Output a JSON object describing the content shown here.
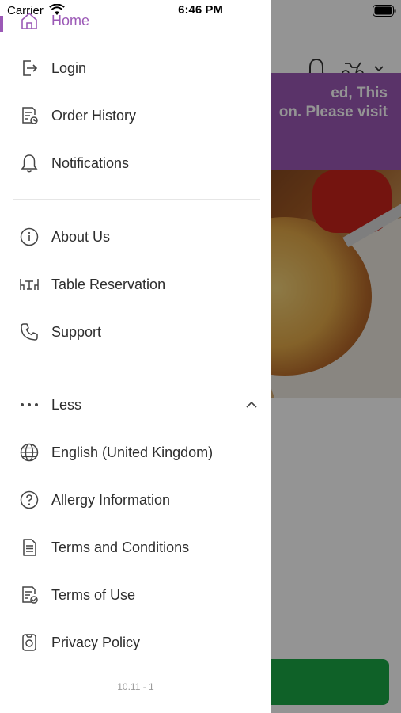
{
  "status_bar": {
    "carrier": "Carrier",
    "time": "6:46 PM"
  },
  "background": {
    "banner_text": "ed, This\non. Please visit\n"
  },
  "menu": {
    "home": "Home",
    "login": "Login",
    "order_history": "Order History",
    "notifications": "Notifications",
    "about_us": "About Us",
    "table_reservation": "Table Reservation",
    "support": "Support",
    "less": "Less",
    "language": "English (United Kingdom)",
    "allergy_information": "Allergy Information",
    "terms_and_conditions": "Terms and Conditions",
    "terms_of_use": "Terms of Use",
    "privacy_policy": "Privacy Policy"
  },
  "version": "10.11 - 1",
  "colors": {
    "accent": "#9b59b6",
    "cta": "#1aa846"
  }
}
